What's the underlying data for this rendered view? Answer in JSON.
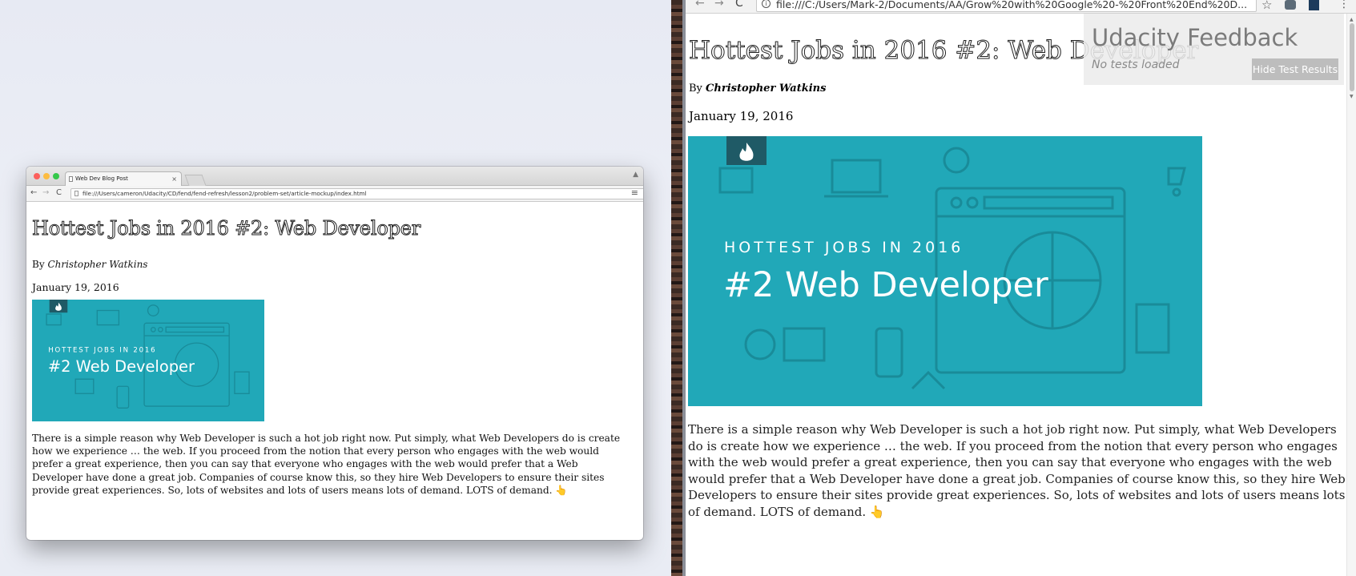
{
  "left_browser": {
    "tab_title": "Web Dev Blog Post",
    "tab_close": "×",
    "url": "file:///Users/cameron/Udacity/CD/fend/fend-refresh/lesson2/problem-set/article-mockup/index.html",
    "back": "←",
    "forward": "→",
    "reload": "C",
    "menu": "≡",
    "person": "▲"
  },
  "right_browser": {
    "url": "file:///C:/Users/Mark-2/Documents/AA/Grow%20with%20Google%20-%20Front%20End%20D...",
    "back": "←",
    "forward": "→",
    "reload": "C",
    "info": "i",
    "star": "☆",
    "menu": "⋮"
  },
  "article": {
    "title": "Hottest Jobs in 2016 #2: Web Developer",
    "byline_prefix": "By",
    "author": "Christopher Watkins",
    "date": "January 19, 2016",
    "hero": {
      "kicker": "HOTTEST JOBS IN 2016",
      "headline": "#2 Web Developer",
      "bg_color": "#21a8b8",
      "badge_color": "#1f5a66",
      "icon": "flame-icon"
    },
    "body": "There is a simple reason why Web Developer is such a hot job right now. Put simply, what Web Developers do is create how we experience … the web. If you proceed from the notion that every person who engages with the web would prefer a great experience, then you can say that everyone who engages with the web would prefer that a Web Developer have done a great job. Companies of course know this, so they hire Web Developers to ensure their sites provide great experiences. So, lots of websites and lots of users means lots of demand. LOTS of demand.",
    "body_emoji": "👆"
  },
  "udacity_feedback": {
    "title": "Udacity Feedback",
    "status": "No tests loaded",
    "button": "Hide Test Results"
  },
  "colors": {
    "hero_teal": "#21a8b8",
    "desktop_bg": "#eceef6"
  }
}
